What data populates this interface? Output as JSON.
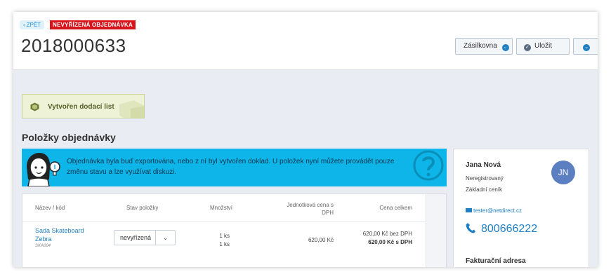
{
  "header": {
    "back_label": "ZPĚT",
    "status_badge": "NEVYŘÍZENÁ OBJEDNÁVKA",
    "order_number": "2018000633",
    "buttons": {
      "zasilkovna": "Zásilkovna",
      "save": "Uložit"
    }
  },
  "delivery_note": {
    "label": "Vytvořen dodací list"
  },
  "items_section": {
    "title": "Položky objednávky",
    "info_banner": "Objednávka byla buď exportována, nebo z ní byl vytvořen doklad. U položek nyní můžete provádět pouze změnu stavu a lze využívat diskuzi.",
    "columns": {
      "name": "Název / kód",
      "state": "Stav položky",
      "quantity": "Množství",
      "unit_price": "Jednotková cena s DPH",
      "total": "Cena celkem"
    },
    "rows": [
      {
        "name": "Sada Skateboard Zebra",
        "code": "SKA004",
        "state": "nevyřízená",
        "qty_1": "1 ks",
        "qty_2": "1 ks",
        "unit_price": "620,00 Kč",
        "total_net": "620,00 Kč bez DPH",
        "total_gross": "620,00 Kč s DPH"
      }
    ]
  },
  "customer": {
    "name": "Jana Nová",
    "registration": "Neregistrovaný",
    "pricelist": "Základní ceník",
    "email": "tester@netdirect.cz",
    "initials": "JN",
    "phone": "800666222",
    "billing_title": "Fakturační adresa"
  },
  "colors": {
    "accent": "#1f7fc4",
    "badge_red": "#d7141b",
    "banner_blue": "#0eb5e8",
    "avatar": "#5b7fc0"
  }
}
